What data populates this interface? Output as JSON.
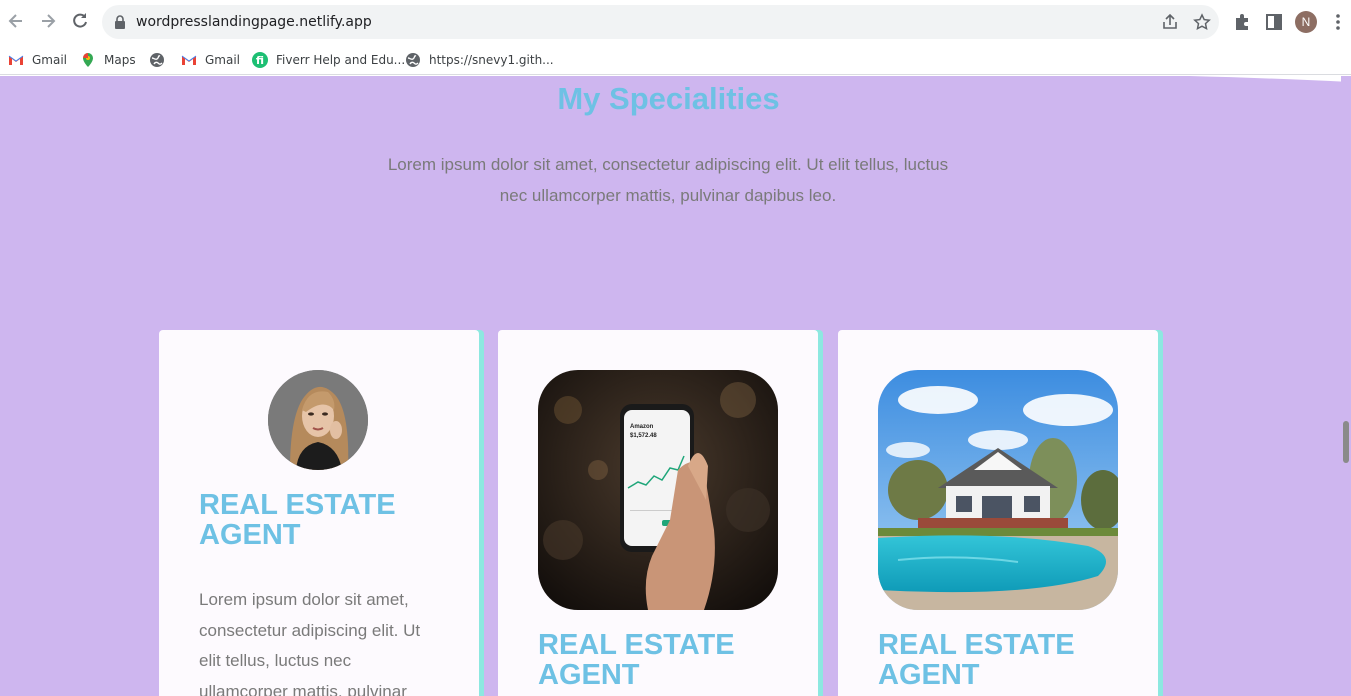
{
  "browser": {
    "url": "wordpresslandingpage.netlify.app",
    "profile_initial": "N",
    "bookmarks": [
      {
        "label": "Gmail",
        "icon": "gmail-icon"
      },
      {
        "label": "Maps",
        "icon": "maps-icon"
      },
      {
        "label": "",
        "icon": "globe-icon"
      },
      {
        "label": "Gmail",
        "icon": "gmail-icon"
      },
      {
        "label": "Fiverr Help and Edu...",
        "icon": "fiverr-icon"
      },
      {
        "label": "https://snevy1.gith...",
        "icon": "globe-icon"
      }
    ]
  },
  "section": {
    "title": "My Specialities",
    "description": "Lorem ipsum dolor sit amet, consectetur adipiscing elit. Ut elit tellus, luctus nec ullamcorper mattis, pulvinar dapibus leo."
  },
  "cards": [
    {
      "title": "REAL ESTATE AGENT",
      "text": "Lorem ipsum dolor sit amet, consectetur adipiscing elit. Ut elit tellus, luctus nec ullamcorper mattis, pulvinar",
      "image": "portrait-photo"
    },
    {
      "title": "REAL ESTATE AGENT",
      "image": "phone-stock-app-photo",
      "phone": {
        "company": "Amazon",
        "price": "$1,572.48"
      }
    },
    {
      "title": "REAL ESTATE AGENT",
      "image": "house-pool-photo"
    }
  ],
  "colors": {
    "page_bg": "#ceb6ef",
    "heading": "#6ec1e4",
    "body_text": "#7a7a7a",
    "card_bg": "#fdfafe",
    "card_accent": "#8de8e0"
  }
}
